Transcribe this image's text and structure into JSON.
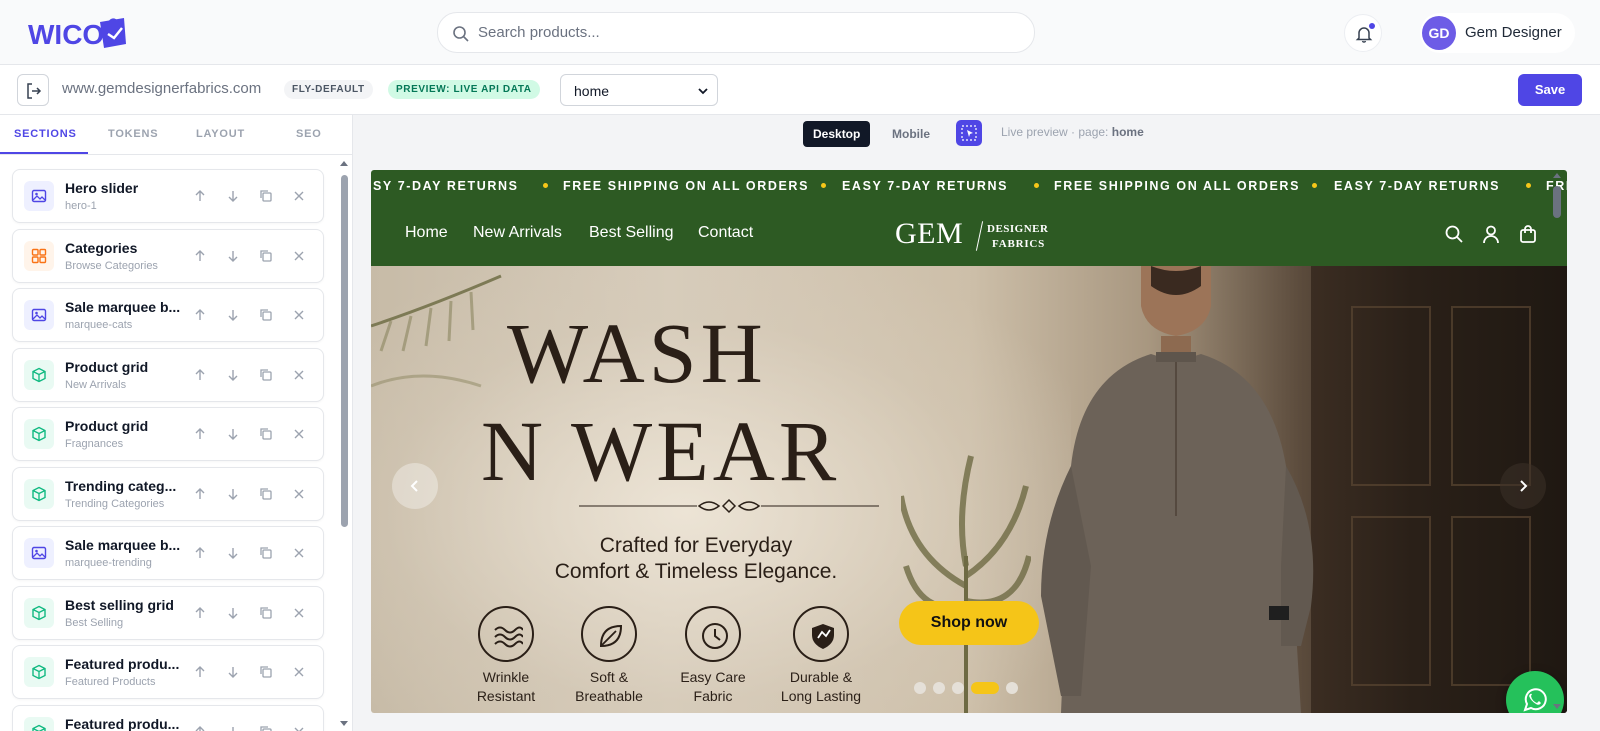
{
  "app": {
    "logo_text": "WICO",
    "search_placeholder": "Search products...",
    "user": {
      "initials": "GD",
      "name": "Gem Designer"
    }
  },
  "editor": {
    "domain": "www.gemdesignerfabrics.com",
    "theme_badge": "FLY-DEFAULT",
    "preview_badge": "PREVIEW: LIVE API DATA",
    "page_select": {
      "selected": "home",
      "options": [
        "home"
      ]
    },
    "save_label": "Save"
  },
  "sidebar": {
    "tabs": [
      {
        "label": "SECTIONS",
        "active": true
      },
      {
        "label": "TOKENS",
        "active": false
      },
      {
        "label": "LAYOUT",
        "active": false
      },
      {
        "label": "SEO",
        "active": false
      }
    ],
    "sections": [
      {
        "title": "Hero slider",
        "subtitle": "hero-1",
        "icon": "image-icon",
        "color": "#4f46e5"
      },
      {
        "title": "Categories",
        "subtitle": "Browse Categories",
        "icon": "grid-icon",
        "color": "#f97316"
      },
      {
        "title": "Sale marquee b...",
        "subtitle": "marquee-cats",
        "icon": "image-icon",
        "color": "#4f46e5"
      },
      {
        "title": "Product grid",
        "subtitle": "New Arrivals",
        "icon": "box-icon",
        "color": "#10b981"
      },
      {
        "title": "Product grid",
        "subtitle": "Fragnances",
        "icon": "box-icon",
        "color": "#10b981"
      },
      {
        "title": "Trending categ...",
        "subtitle": "Trending Categories",
        "icon": "box-icon",
        "color": "#10b981"
      },
      {
        "title": "Sale marquee b...",
        "subtitle": "marquee-trending",
        "icon": "image-icon",
        "color": "#4f46e5"
      },
      {
        "title": "Best selling grid",
        "subtitle": "Best Selling",
        "icon": "box-icon",
        "color": "#10b981"
      },
      {
        "title": "Featured produ...",
        "subtitle": "Featured Products",
        "icon": "box-icon",
        "color": "#10b981"
      },
      {
        "title": "Featured produ...",
        "subtitle": "",
        "icon": "box-icon",
        "color": "#10b981"
      }
    ]
  },
  "canvas": {
    "view_desktop": "Desktop",
    "view_mobile": "Mobile",
    "live_text": "Live preview · page: ",
    "live_page": "home"
  },
  "storefront": {
    "marquee": [
      "SY 7-DAY RETURNS",
      "FREE SHIPPING ON ALL ORDERS",
      "EASY 7-DAY RETURNS",
      "FREE SHIPPING ON ALL ORDERS",
      "EASY 7-DAY RETURNS",
      "FRE"
    ],
    "nav": [
      "Home",
      "New Arrivals",
      "Best Selling",
      "Contact"
    ],
    "brand": {
      "main": "GEM",
      "line1": "DESIGNER",
      "line2": "FABRICS"
    },
    "hero": {
      "title_line1": "WASH",
      "title_line2": "N WEAR",
      "tagline_line1": "Crafted for Everyday",
      "tagline_line2": "Comfort & Timeless Elegance.",
      "features": [
        {
          "line1": "Wrinkle",
          "line2": "Resistant",
          "icon": "waves-icon"
        },
        {
          "line1": "Soft &",
          "line2": "Breathable",
          "icon": "leaf-icon"
        },
        {
          "line1": "Easy Care",
          "line2": "Fabric",
          "icon": "clock-icon"
        },
        {
          "line1": "Durable &",
          "line2": "Long Lasting",
          "icon": "shield-icon"
        }
      ],
      "cta": "Shop now",
      "slides_count": 5,
      "active_slide": 4
    },
    "accent": "#f5c518",
    "header_color": "#2d5a23"
  }
}
